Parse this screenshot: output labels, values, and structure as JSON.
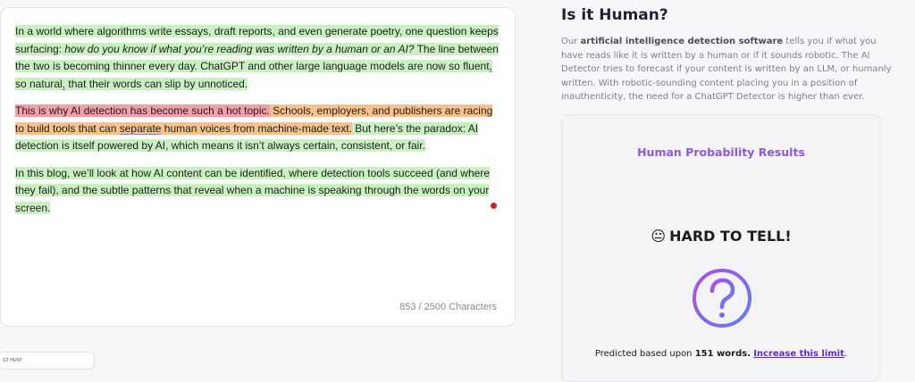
{
  "editor": {
    "paragraph1": {
      "s1": "In a world where algorithms write essays, draft reports, and even generate poetry, one question keeps surfacing: ",
      "s1_italic": "how do you know if what you’re reading was written by a human or an AI?",
      "s2": " The line between the two is becoming thinner every day. ChatGPT and other large language models are now so fluent",
      "s2_comma": ",",
      "s3": " so natural",
      "s3_comma": ",",
      "s4": " that their words can slip by unnoticed."
    },
    "paragraph2": {
      "red": "This is why AI detection has become such a hot topic.",
      "orange_a": " Schools, employers, and publishers are racing to build tools that can ",
      "orange_sp": "separate",
      "orange_b": " human voices from machine-made text.",
      "green": " But here’s the paradox: AI detection is itself powered by AI, which means it isn’t always certain, consistent, or fair."
    },
    "paragraph3": {
      "green": "In this blog, we’ll look at how AI content can be identified, where detection tools succeed (and where they fail), and the subtle patterns that reveal when a machine is speaking through the words on your screen."
    },
    "char_count": "853 / 2500 Characters"
  },
  "side_tab": {
    "label": "GT HUNT"
  },
  "info": {
    "title": "Is it Human?",
    "desc_before": "Our ",
    "desc_bold": "artificial intelligence detection software",
    "desc_after": " tells you if what you have reads like it is written by a human or if it sounds robotic. The AI Detector tries to forecast if your content is written by an LLM, or humanly written. With robotic-sounding content placing you in a position of inauthenticity, the need for a ChatGPT Detector is higher than ever."
  },
  "result": {
    "heading": "Human Probability Results",
    "verdict_icon": "😐",
    "verdict": "HARD TO TELL!",
    "question_icon": "question-mark-circle-icon",
    "predicted_prefix": "Predicted based upon ",
    "word_count": "151 words.",
    "link": "Increase this limit",
    "suffix": "."
  },
  "colors": {
    "human_green": "#c9f0c1",
    "ai_red": "#f5a0a8",
    "mixed_orange": "#f9c28c",
    "accent_purple": "#8e5ad8",
    "link_purple": "#5a2fc4",
    "cursor_red": "#d8201c"
  }
}
